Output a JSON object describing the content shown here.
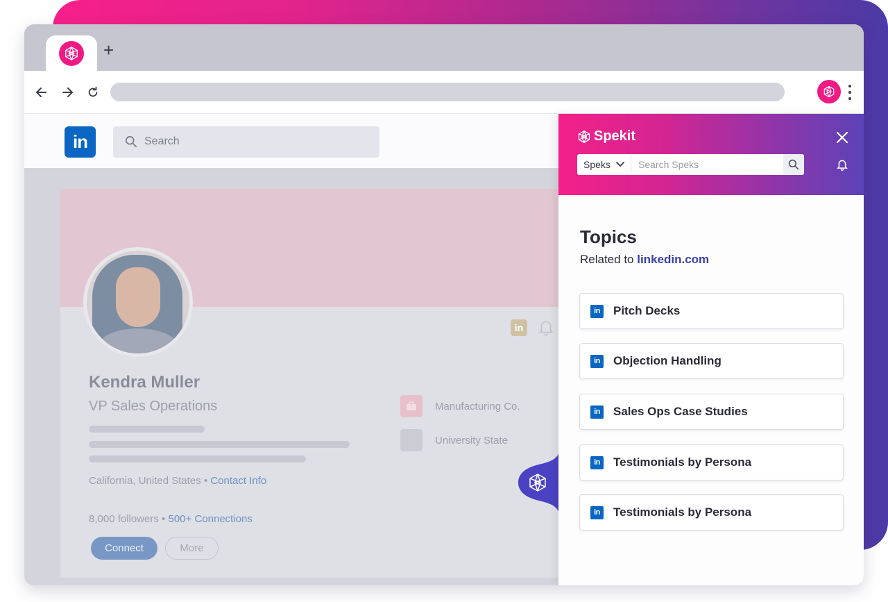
{
  "colors": {
    "brand_pink": "#f01a84",
    "linkedin_blue": "#0a66c2",
    "accent_purple": "#5b43b8"
  },
  "browser": {
    "new_tab_symbol": "+"
  },
  "linkedin": {
    "logo_text": "in",
    "search_placeholder": "Search",
    "profile": {
      "name": "Kendra Muller",
      "title": "VP Sales Operations",
      "location": "California, United States",
      "separator": " • ",
      "contact_label": "Contact Info",
      "followers": "8,000 followers",
      "connections": "500+ Connections",
      "connect_label": "Connect",
      "more_label": "More",
      "company": "Manufacturing Co.",
      "school": "University State"
    }
  },
  "spekit": {
    "brand": "Spekit",
    "search_scope": "Speks",
    "search_placeholder": "Search Speks",
    "topics_title": "Topics",
    "related_prefix": "Related to ",
    "related_domain": "linkedin.com",
    "topics": [
      {
        "label": "Pitch Decks",
        "icon": "linkedin-icon"
      },
      {
        "label": "Objection Handling",
        "icon": "linkedin-icon"
      },
      {
        "label": "Sales Ops Case Studies",
        "icon": "linkedin-icon"
      },
      {
        "label": "Testimonials by Persona",
        "icon": "linkedin-icon"
      },
      {
        "label": "Testimonials by Persona",
        "icon": "linkedin-icon"
      }
    ]
  }
}
